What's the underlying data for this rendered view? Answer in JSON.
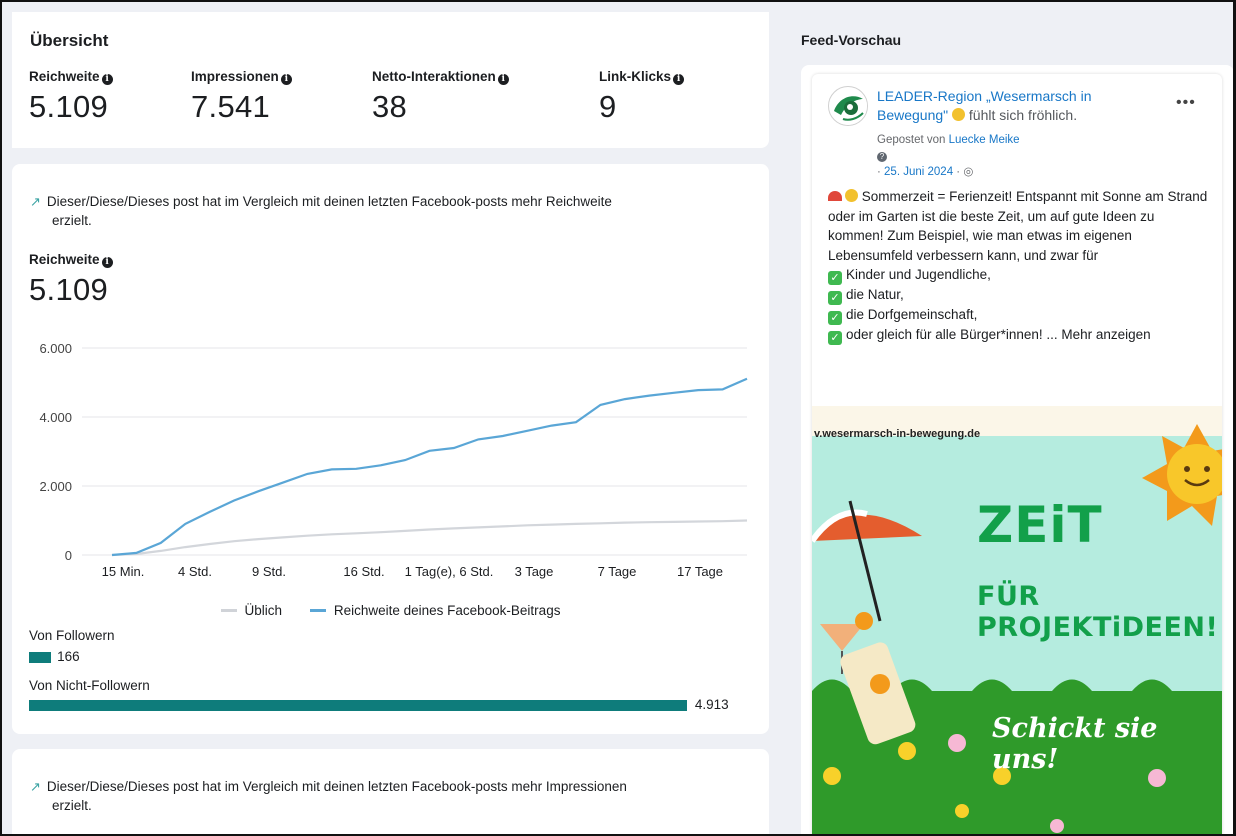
{
  "overview": {
    "title": "Übersicht",
    "metrics": [
      {
        "label": "Reichweite",
        "value": "5.109"
      },
      {
        "label": "Impressionen",
        "value": "7.541"
      },
      {
        "label": "Netto-Interaktionen",
        "value": "38"
      },
      {
        "label": "Link-Klicks",
        "value": "9"
      }
    ]
  },
  "reach_card": {
    "insight": "Dieser/Diese/Dieses post hat im Vergleich mit deinen letzten Facebook-posts mehr Reichweite",
    "insight_cont": "erzielt.",
    "metric_label": "Reichweite",
    "metric_value": "5.109",
    "legend": [
      {
        "name": "Üblich",
        "color": "#d0d3d8"
      },
      {
        "name": "Reichweite deines Facebook-Beitrags",
        "color": "#5aa6d6"
      }
    ],
    "followers": {
      "label": "Von Followern",
      "value": "166",
      "fraction": 0.0325
    },
    "non_followers": {
      "label": "Von Nicht-Followern",
      "value": "4.913",
      "fraction": 0.9675
    }
  },
  "chart_data": {
    "type": "line",
    "x_ticks": [
      "15 Min.",
      "4 Std.",
      "9 Std.",
      "16 Std.",
      "1 Tag(e), 6 Std.",
      "3 Tage",
      "7 Tage",
      "17 Tage"
    ],
    "y_ticks": [
      "0",
      "2.000",
      "4.000",
      "6.000"
    ],
    "ylim": [
      0,
      6000
    ],
    "grid": true,
    "legend_position": "bottom",
    "series": [
      {
        "name": "Reichweite deines Facebook-Beitrags",
        "values": [
          0,
          60,
          350,
          900,
          1250,
          1580,
          1850,
          2100,
          2350,
          2480,
          2500,
          2600,
          2750,
          3020,
          3100,
          3350,
          3450,
          3600,
          3750,
          3850,
          4350,
          4520,
          4620,
          4700,
          4780,
          4800,
          5109
        ]
      },
      {
        "name": "Üblich",
        "values": [
          0,
          30,
          120,
          230,
          320,
          400,
          460,
          510,
          560,
          600,
          630,
          660,
          700,
          740,
          770,
          800,
          830,
          860,
          880,
          900,
          920,
          940,
          950,
          960,
          970,
          980,
          1000
        ]
      }
    ]
  },
  "impressions_card": {
    "insight": "Dieser/Diese/Dieses post hat im Vergleich mit deinen letzten Facebook-posts mehr Impressionen",
    "insight_cont": "erzielt."
  },
  "feed": {
    "title": "Feed-Vorschau",
    "page_name": "LEADER-Region „Wesermarsch in Bewegung\"",
    "feeling": "fühlt sich fröhlich.",
    "posted_by_prefix": "Gepostet von",
    "posted_by": "Luecke Meike",
    "date": "25. Juni 2024",
    "more": "•••",
    "text_lines": [
      "Sommerzeit = Ferienzeit! Entspannt mit Sonne am Strand oder im Garten ist die beste Zeit, um auf gute Ideen zu kommen! Zum Beispiel, wie man etwas im eigenen Lebensumfeld verbessern kann, und zwar für"
    ],
    "checklist": [
      "Kinder und Jugendliche,",
      "die Natur,",
      "die Dorfgemeinschaft,",
      "oder gleich für alle Bürger*innen! ... Mehr anzeigen"
    ],
    "image": {
      "url": "v.wesermarsch-in-bewegung.de",
      "headline": "ZEiT",
      "subline": "FÜR PROJEKTiDEEN!",
      "cta": "Schickt sie uns!",
      "colors": {
        "sky": "#b5ecdf",
        "grass": "#2f9a2a",
        "text_green": "#12a04a",
        "sun": "#f39a1b"
      }
    }
  }
}
